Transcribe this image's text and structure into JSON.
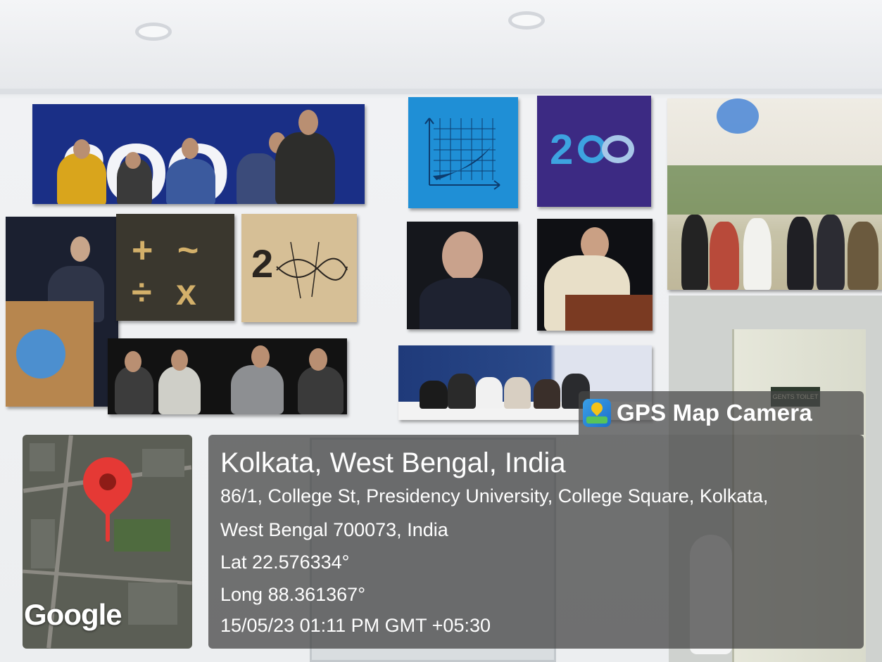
{
  "overlay": {
    "app_name": "GPS Map Camera",
    "location_title": "Kolkata, West Bengal, India",
    "address_line1": "86/1, College St, Presidency University, College Square, Kolkata,",
    "address_line2": "West Bengal 700073, India",
    "latitude": "Lat 22.576334°",
    "longitude": "Long 88.361367°",
    "datetime": "15/05/23 01:11 PM GMT +05:30",
    "map_provider": "Google"
  },
  "scene": {
    "panel_text_a": "2OO",
    "panel_text_b": "2",
    "math_symbols": "+ ~ ÷ x",
    "door_sign": "GENTS TOILET"
  },
  "colors": {
    "pin": "#e53935",
    "overlay_bg": "rgba(62,62,62,0.72)",
    "banner_blue": "#1a2f86",
    "purple_panel": "#3c2a83",
    "cyan_panel": "#1f8fd6"
  }
}
